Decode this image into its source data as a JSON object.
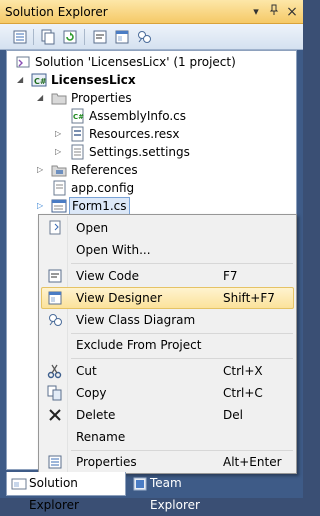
{
  "window": {
    "title": "Solution Explorer",
    "pin_glyph": "▾",
    "pushpin_glyph": "ᛘ",
    "close_glyph": "×"
  },
  "toolbar": {
    "icons": [
      "properties-icon",
      "show-all-files-icon",
      "refresh-icon",
      "view-code-icon",
      "view-designer-icon",
      "class-diagram-icon"
    ]
  },
  "tree": {
    "solution": "Solution 'LicensesLicx' (1 project)",
    "project": "LicensesLicx",
    "properties": "Properties",
    "assembly_info": "AssemblyInfo.cs",
    "resources": "Resources.resx",
    "settings": "Settings.settings",
    "references": "References",
    "app_config": "app.config",
    "form1": "Form1.cs"
  },
  "context_menu": {
    "open": "Open",
    "open_with": "Open With...",
    "view_code": "View Code",
    "view_code_sc": "F7",
    "view_designer": "View Designer",
    "view_designer_sc": "Shift+F7",
    "view_class_diagram": "View Class Diagram",
    "exclude": "Exclude From Project",
    "cut": "Cut",
    "cut_sc": "Ctrl+X",
    "copy": "Copy",
    "copy_sc": "Ctrl+C",
    "delete": "Delete",
    "delete_sc": "Del",
    "rename": "Rename",
    "properties": "Properties",
    "properties_sc": "Alt+Enter"
  },
  "tabs": {
    "solution_explorer": "Solution Explorer",
    "team_explorer": "Team Explorer"
  },
  "colors": {
    "title_bar": "#f5c967",
    "frame": "#3e5b87",
    "highlight": "#fbe29b"
  }
}
